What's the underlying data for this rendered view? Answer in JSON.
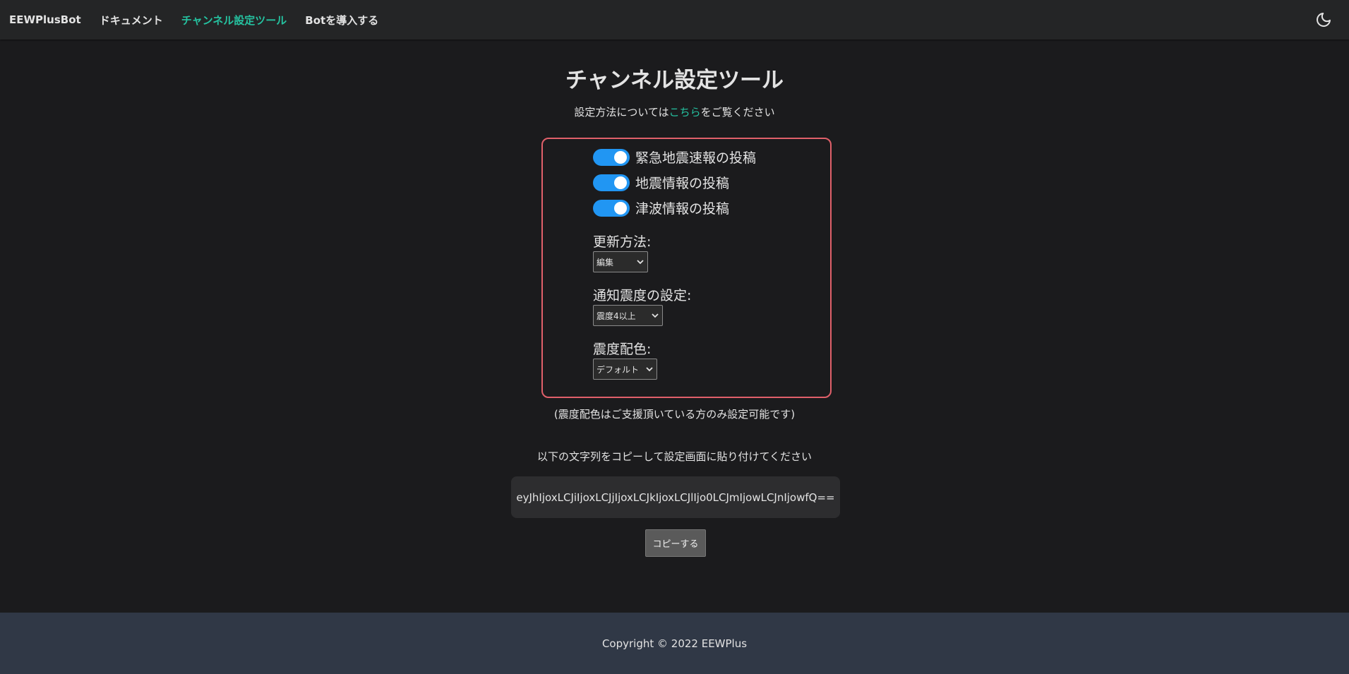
{
  "nav": {
    "brand": "EEWPlusBot",
    "items": [
      "ドキュメント",
      "チャンネル設定ツール",
      "Botを導入する"
    ],
    "active_index": 1,
    "theme_icon": "moon-icon"
  },
  "page": {
    "title": "チャンネル設定ツール",
    "intro_before": "設定方法については",
    "intro_link": "こちら",
    "intro_after": "をご覧ください"
  },
  "settings": {
    "toggles": [
      {
        "label": "緊急地震速報の投稿",
        "on": true
      },
      {
        "label": "地震情報の投稿",
        "on": true
      },
      {
        "label": "津波情報の投稿",
        "on": true
      }
    ],
    "update_method_label": "更新方法:",
    "update_method_value": "編集",
    "intensity_label": "通知震度の設定:",
    "intensity_value": "震度4以上",
    "color_label": "震度配色:",
    "color_value": "デフォルト"
  },
  "note": "(震度配色はご支援頂いている方のみ設定可能です)",
  "copy_instruction": "以下の文字列をコピーして設定画面に貼り付けてください",
  "code": "eyJhIjoxLCJiIjoxLCJjIjoxLCJkIjoxLCJlIjo0LCJmIjowLCJnIjowfQ==",
  "copy_button": "コピーする",
  "footer": "Copyright © 2022 EEWPlus",
  "colors": {
    "accent": "#25c2a0",
    "switch": "#2196f3",
    "highlight_border": "#e0606a"
  }
}
